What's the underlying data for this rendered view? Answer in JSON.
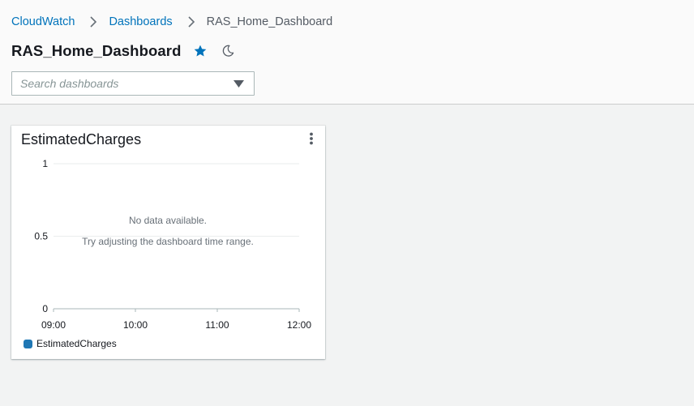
{
  "breadcrumb": {
    "items": [
      {
        "label": "CloudWatch",
        "link": true
      },
      {
        "label": "Dashboards",
        "link": true
      },
      {
        "label": "RAS_Home_Dashboard",
        "link": false
      }
    ]
  },
  "page": {
    "title": "RAS_Home_Dashboard",
    "favorite_icon": "star-icon",
    "theme_icon": "moon-icon"
  },
  "search": {
    "placeholder": "Search dashboards",
    "value": ""
  },
  "colors": {
    "link": "#0073bb",
    "star": "#0073bb",
    "series": "#1f77b4"
  },
  "widget": {
    "title": "EstimatedCharges",
    "menu_icon": "more-vertical-icon",
    "empty_line1": "No data available.",
    "empty_line2": "Try adjusting the dashboard time range.",
    "legend": [
      {
        "label": "EstimatedCharges",
        "color": "#1f77b4"
      }
    ]
  },
  "chart_data": {
    "type": "line",
    "title": "EstimatedCharges",
    "x_ticks": [
      "09:00",
      "10:00",
      "11:00",
      "12:00"
    ],
    "y_ticks": [
      "1",
      "0.5",
      "0"
    ],
    "ylim": [
      0,
      1
    ],
    "series": [
      {
        "name": "EstimatedCharges",
        "values": []
      }
    ],
    "grid": true,
    "legend_position": "bottom-left"
  }
}
